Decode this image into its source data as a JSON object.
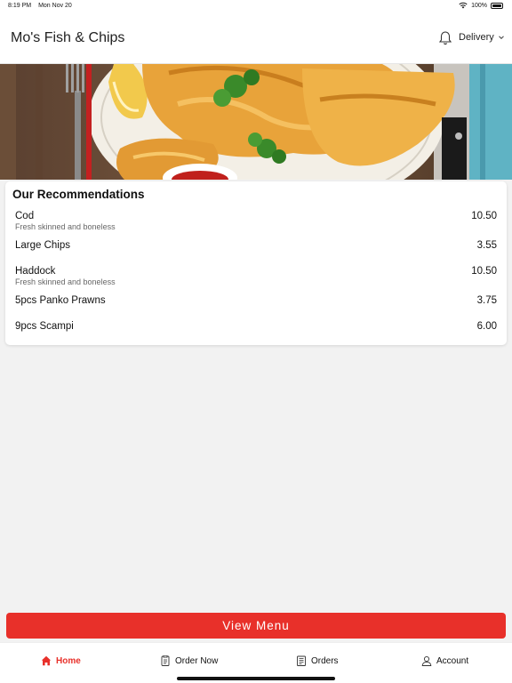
{
  "status_bar": {
    "time": "8:19 PM",
    "date": "Mon Nov 20",
    "battery": "100%"
  },
  "header": {
    "title": "Mo's Fish & Chips",
    "delivery_label": "Delivery"
  },
  "recommendations": {
    "title": "Our Recommendations",
    "items": [
      {
        "name": "Cod",
        "description": "Fresh skinned and boneless",
        "price": "10.50"
      },
      {
        "name": "Large Chips",
        "description": "",
        "price": "3.55"
      },
      {
        "name": "Haddock",
        "description": "Fresh skinned and boneless",
        "price": "10.50"
      },
      {
        "name": "5pcs Panko Prawns",
        "description": "",
        "price": "3.75"
      },
      {
        "name": "9pcs Scampi",
        "description": "",
        "price": "6.00"
      }
    ]
  },
  "view_menu_label": "View Menu",
  "nav": {
    "home": "Home",
    "order_now": "Order Now",
    "orders": "Orders",
    "account": "Account"
  },
  "colors": {
    "accent": "#e8302a"
  }
}
